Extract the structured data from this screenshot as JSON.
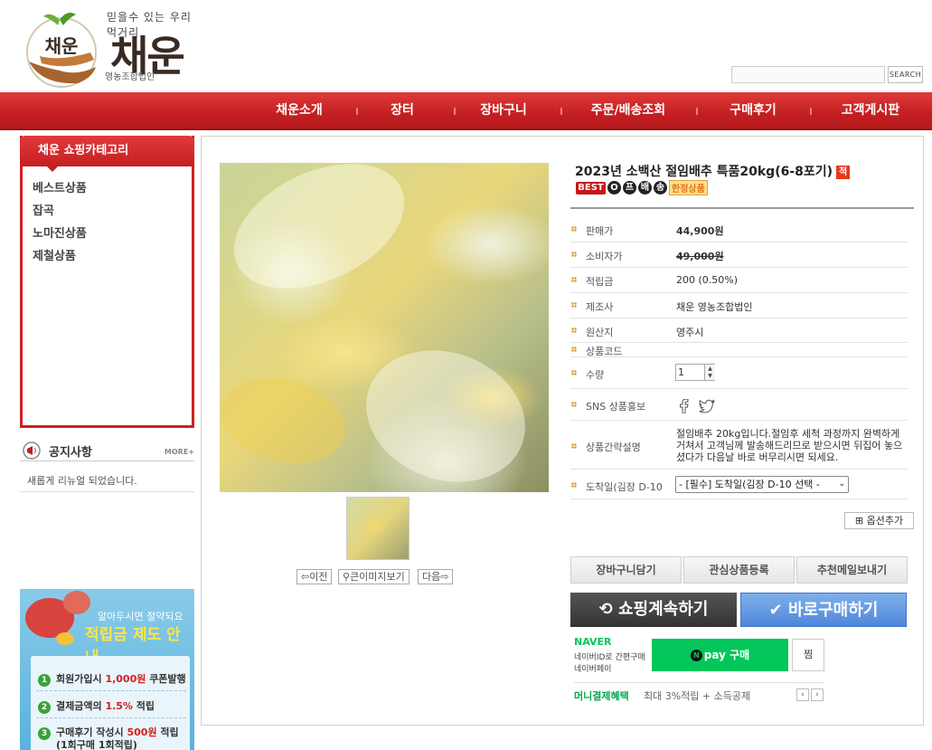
{
  "header": {
    "logo_tagline": "믿을수 있는 우리 먹거리",
    "logo_badge": "채운",
    "logo_name": "채운",
    "logo_sub": "영농조합법인",
    "search_placeholder": "",
    "search_button": "SEARCH"
  },
  "nav": [
    "채운소개",
    "장터",
    "장바구니",
    "주문/배송조회",
    "구매후기",
    "고객게시판"
  ],
  "sidebar": {
    "category_title": "채운 쇼핑카테고리",
    "categories": [
      "베스트상품",
      "잡곡",
      "노마진상품",
      "제철상품"
    ],
    "notice_title": "공지사항",
    "notice_more": "MORE+",
    "notice_text": "새롭게 리뉴얼 되었습니다.",
    "banner": {
      "line1": "알아두시면 절약되요",
      "line2": "적립금 제도 안내",
      "benefits": [
        {
          "num": "1",
          "pre": "회원가입시 ",
          "hl": "1,000원",
          "post": " 쿠폰발행"
        },
        {
          "num": "2",
          "pre": "결제금액의 ",
          "hl": "1.5%",
          "post": " 적립"
        },
        {
          "num": "3",
          "pre": "구매후기 작성시 ",
          "hl": "500원",
          "post": " 적립"
        }
      ],
      "benefit3_sub": "(1회구매 1회적립)"
    }
  },
  "product": {
    "name": "2023년 소백산 절임배추 특품20kg(6-8포기)",
    "name_badge": "적",
    "icons": [
      "BEST",
      "O",
      "프",
      "배",
      "송"
    ],
    "limit_label": "한정상품",
    "fields": {
      "price_label": "판매가",
      "price": "44,900원",
      "consumer_label": "소비자가",
      "consumer_price": "49,000원",
      "points_label": "적립금",
      "points": "200 (0.50%)",
      "maker_label": "제조사",
      "maker": "채운 영농조합법인",
      "origin_label": "원산지",
      "origin": "영주시",
      "code_label": "상품코드",
      "code": "",
      "qty_label": "수량",
      "qty": "1",
      "sns_label": "SNS 상품홍보",
      "desc_label": "상품간략설명",
      "desc": "절임배추 20kg입니다.절임후 세척 과정까지 완벽하게 거쳐서 고객님께 발송해드리므로 받으시면 뒤집어 놓으셨다가 다음날 바로 버무리시면 되세요.",
      "arrival_label": "도착일(김장 D-10",
      "arrival_value": "- [필수] 도착일(김장 D-10 선택 -"
    },
    "option_add": "옵션추가",
    "image_buttons": {
      "prev": "이전",
      "zoom": "큰이미지보기",
      "next": "다음"
    },
    "buttons": {
      "cart": "장바구니담기",
      "wish": "관심상품등록",
      "recommend": "추천메일보내기",
      "continue": "쇼핑계속하기",
      "buy": "바로구매하기"
    },
    "naver": {
      "logo": "NAVER",
      "desc1": "네이버ID로 간편구매",
      "desc2": "네이버페이",
      "pay_button": "pay 구매",
      "zzim": "찜",
      "money_label": "머니결제혜택",
      "money_desc": "최대 3%적립 + 소득공제"
    }
  },
  "colors": {
    "brand_red": "#c41f22",
    "naver_green": "#03c75a",
    "buy_blue": "#4f86d8"
  }
}
